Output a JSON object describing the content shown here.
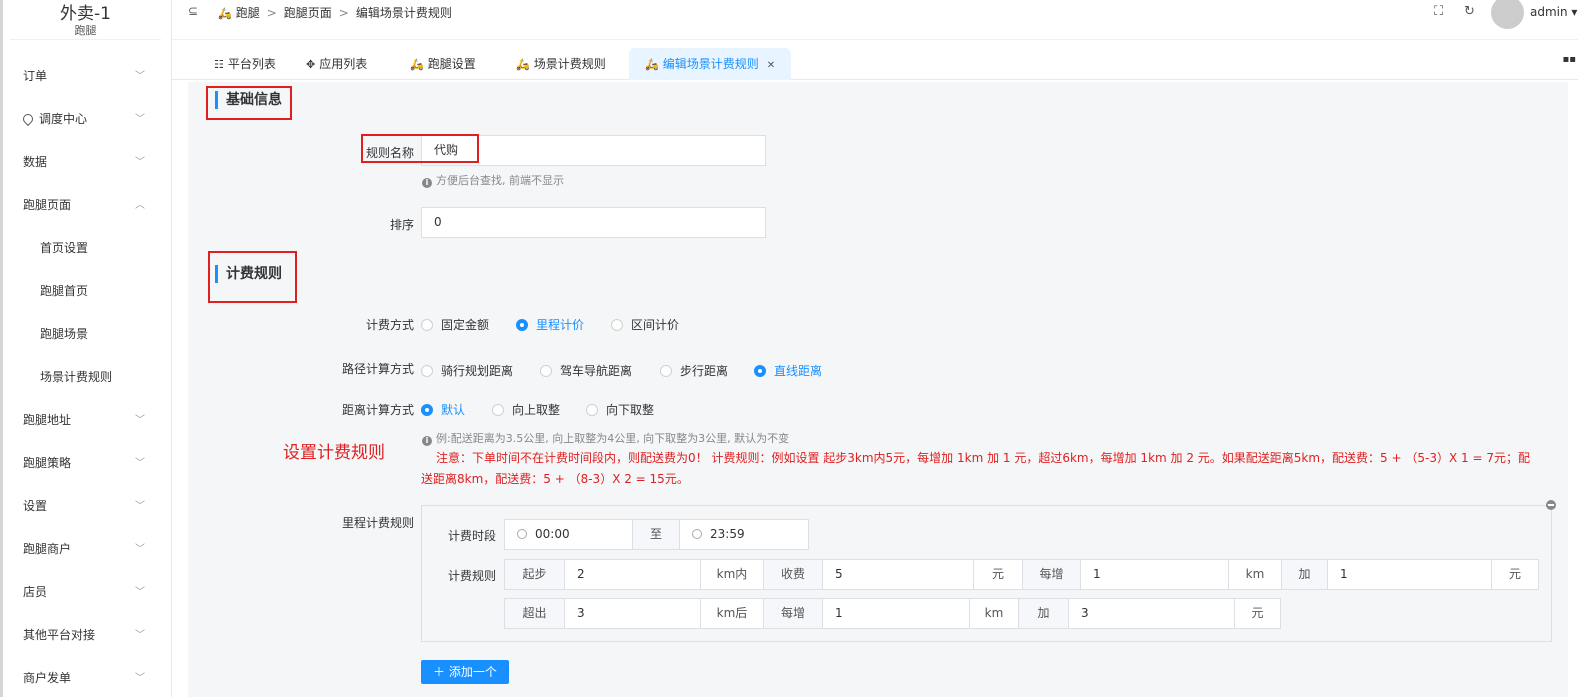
{
  "brand": {
    "title": "外卖-1",
    "subtitle": "跑腿"
  },
  "sidebar": {
    "items": [
      {
        "label": "订单"
      },
      {
        "label": "调度中心"
      },
      {
        "label": "数据"
      },
      {
        "label": "跑腿页面"
      },
      {
        "label": "首页设置"
      },
      {
        "label": "跑腿首页"
      },
      {
        "label": "跑腿场景"
      },
      {
        "label": "场景计费规则"
      },
      {
        "label": "跑腿地址"
      },
      {
        "label": "跑腿策略"
      },
      {
        "label": "设置"
      },
      {
        "label": "跑腿商户"
      },
      {
        "label": "店员"
      },
      {
        "label": "其他平台对接"
      },
      {
        "label": "商户发单"
      }
    ]
  },
  "breadcrumb": {
    "items": [
      "跑腿",
      "跑腿页面",
      "编辑场景计费规则"
    ],
    "sep": ">"
  },
  "header": {
    "user": "admin"
  },
  "tabs": [
    {
      "label": "平台列表"
    },
    {
      "label": "应用列表"
    },
    {
      "label": "跑腿设置"
    },
    {
      "label": "场景计费规则"
    },
    {
      "label": "编辑场景计费规则"
    }
  ],
  "form": {
    "section_basic": "基础信息",
    "name_label": "规则名称",
    "name_value": "代购",
    "name_help": "方便后台查找, 前端不显示",
    "sort_label": "排序",
    "sort_value": "0",
    "section_billing": "计费规则",
    "billing_mode_label": "计费方式",
    "billing_modes": [
      "固定金额",
      "里程计价",
      "区间计价"
    ],
    "billing_mode_selected": "里程计价",
    "route_label": "路径计算方式",
    "route_modes": [
      "骑行规划距离",
      "驾车导航距离",
      "步行距离",
      "直线距离"
    ],
    "route_selected": "直线距离",
    "distance_label": "距离计算方式",
    "distance_modes": [
      "默认",
      "向上取整",
      "向下取整"
    ],
    "distance_selected": "默认",
    "distance_help": "例:配送距离为3.5公里, 向上取整为4公里, 向下取整为3公里, 默认为不变",
    "note": "注意：下单时间不在计费时间段内，则配送费为0！ 计费规则：例如设置 起步3km内5元，每增加 1km 加 1 元，超过6km，每增加 1km 加 2 元。如果配送距离5km，配送费：5 + （5-3）X 1 = 7元；配送距离8km，配送费：5 + （8-3）X 2 = 15元。",
    "annotation": "设置计费规则",
    "mileage_label": "里程计费规则",
    "rule": {
      "period_label": "计费时段",
      "start_time": "00:00",
      "to_label": "至",
      "end_time": "23:59",
      "rules_label": "计费规则",
      "row1": {
        "start_label": "起步",
        "start_value": "2",
        "start_unit": "km内",
        "fee_label": "收费",
        "fee_value": "5",
        "fee_unit": "元",
        "each_label": "每增",
        "each_value": "1",
        "each_unit": "km",
        "add_label": "加",
        "add_value": "1",
        "add_unit": "元"
      },
      "row2": {
        "over_label": "超出",
        "over_value": "3",
        "over_unit": "km后",
        "each_label": "每增",
        "each_value": "1",
        "each_unit": "km",
        "add_label": "加",
        "add_value": "3",
        "add_unit": "元"
      }
    },
    "add_button": "添加一个"
  }
}
